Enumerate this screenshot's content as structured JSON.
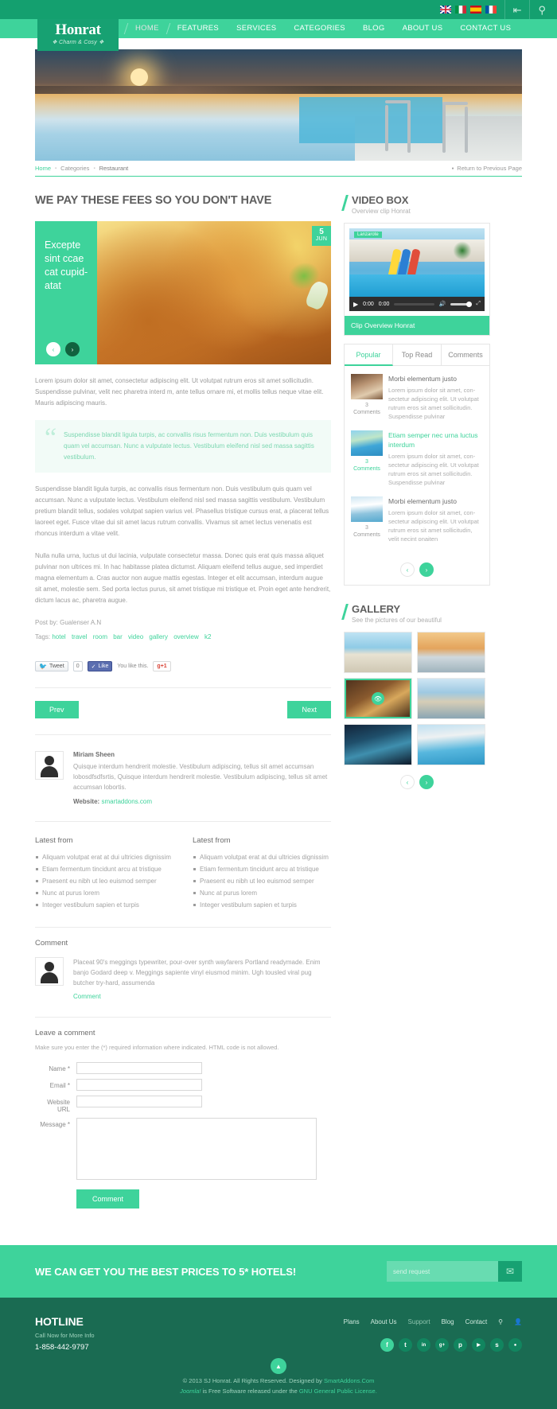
{
  "topbar": {
    "flags": [
      "uk-flag-icon",
      "italy-flag-icon",
      "spain-flag-icon",
      "france-flag-icon"
    ],
    "share_icon": "share-icon",
    "search_icon": "search-icon"
  },
  "logo": {
    "main": "Honrat",
    "sub": "Charm & Cosy"
  },
  "nav": [
    {
      "label": "HOME",
      "active": true
    },
    {
      "label": "FEATURES",
      "active": false
    },
    {
      "label": "SERVICES",
      "active": false
    },
    {
      "label": "CATEGORIES",
      "active": false
    },
    {
      "label": "BLOG",
      "active": false
    },
    {
      "label": "ABOUT US",
      "active": false
    },
    {
      "label": "CONTACT US",
      "active": false
    }
  ],
  "breadcrumb": {
    "home": "Home",
    "categories": "Categories",
    "current": "Restaurant",
    "return": "Return to Previous Page"
  },
  "article": {
    "title": "WE PAY THESE FEES SO YOU DON'T HAVE",
    "feature_caption": "Excepte sint ccae cat cupid-atat",
    "date_day": "5",
    "date_month": "JUN",
    "p1": "Lorem ipsum dolor sit amet, consectetur adipiscing elit. Ut volutpat rutrum eros sit amet sollicitudin. Suspendisse pulvinar, velit nec pharetra interd m, ante tellus ornare mi, et mollis tellus neque vitae elit. Mauris adipiscing mauris.",
    "quote": "Suspendisse blandit ligula turpis, ac convallis risus fermentum non. Duis vestibulum quis quam vel accumsan. Nunc a vulputate lectus. Vestibulum eleifend nisl sed massa sagittis vestibulum.",
    "p2": "Suspendisse blandit ligula turpis, ac convallis risus fermentum non. Duis vestibulum quis quam vel accumsan. Nunc a vulputate lectus. Vestibulum eleifend nisl sed massa sagittis vestibulum. Vestibulum pretium blandit tellus, sodales volutpat sapien varius vel. Phasellus tristique cursus erat, a placerat tellus laoreet eget. Fusce vitae dui sit amet lacus rutrum convallis. Vivamus sit amet lectus venenatis est rhoncus interdum a vitae velit.",
    "p3": "Nulla nulla urna, luctus ut dui lacinia, vulputate consectetur massa. Donec quis erat quis massa aliquet pulvinar non ultrices mi. In hac habitasse platea dictumst. Aliquam eleifend tellus augue, sed imperdiet magna elementum a. Cras auctor non augue mattis egestas. Integer et elit accumsan, interdum augue sit amet, molestie sem. Sed porta lectus purus, sit amet tristique mi tristique et. Proin eget ante hendrerit, dictum lacus ac, pharetra augue.",
    "post_by": "Post by: Gualenser A.N",
    "tags_label": "Tags:",
    "tags": [
      "hotel",
      "travel",
      "room",
      "bar",
      "video",
      "gallery",
      "overview",
      "k2"
    ]
  },
  "social": {
    "tweet_label": "Tweet",
    "tweet_count": "0",
    "like_label": "Like",
    "like_note": "You like this.",
    "gplus_label": "+1"
  },
  "pager": {
    "prev": "Prev",
    "next": "Next"
  },
  "author": {
    "name": "Miriam Sheen",
    "bio": "Quisque interdum hendrerit molestie. Vestibulum adipiscing, tellus sit amet accumsan lobosdfsdfsrtis, Quisque interdum hendrerit molestie. Vestibulum adipiscing, tellus sit amet accumsan lobortis.",
    "website_label": "Website:",
    "website": "smartaddons.com"
  },
  "latest_left": {
    "title": "Latest from",
    "items": [
      "Aliquam volutpat erat at dui ultricies dignissim",
      "Etiam fermentum tincidunt arcu at tristique",
      "Praesent eu nibh ut leo euismod semper",
      "Nunc at purus lorem",
      "Integer vestibulum sapien et turpis"
    ]
  },
  "latest_right": {
    "title": "Latest from",
    "items": [
      "Aliquam volutpat erat at dui ultricies dignissim",
      "Etiam fermentum tincidunt arcu at tristique",
      "Praesent eu nibh ut leo euismod semper",
      "Nunc at purus lorem",
      "Integer vestibulum sapien et turpis"
    ]
  },
  "comments": {
    "heading": "Comment",
    "body": "Placeat 90's meggings typewriter, pour-over synth wayfarers Portland readymade. Enim banjo Godard deep v. Meggings sapiente vinyl eiusmod minim. Ugh tousled viral pug butcher try-hard, assumenda",
    "reply": "Comment"
  },
  "form": {
    "heading": "Leave a comment",
    "note": "Make sure you enter the (*) required information where indicated. HTML code is not allowed.",
    "name_label": "Name *",
    "email_label": "Email *",
    "url_label": "Website URL",
    "message_label": "Message *",
    "name_value": "",
    "email_value": "",
    "url_value": "",
    "message_value": "",
    "submit": "Comment"
  },
  "video_box": {
    "title": "VIDEO BOX",
    "subtitle": "Overview clip Honrat",
    "badge": "Lanzarote",
    "current_time": "0:00",
    "total_time": "0:00",
    "caption": "Clip Overview Honrat",
    "play_icon": "play-icon",
    "volume_icon": "volume-icon",
    "fullscreen_icon": "fullscreen-icon"
  },
  "tabs": [
    {
      "label": "Popular",
      "active": true
    },
    {
      "label": "Top Read",
      "active": false
    },
    {
      "label": "Comments",
      "active": false
    }
  ],
  "posts": [
    {
      "title": "Morbi elementum justo",
      "highlight": false,
      "count": "3",
      "count_label": "Comments",
      "excerpt": "Lorem ipsum dolor sit amet, con-sectetur adipiscing elit. Ut volutpat rutrum eros sit amet sollicitudin. Suspendisse pulvinar",
      "thumb": "hotel-room-thumb"
    },
    {
      "title": "Etiam semper nec urna luctus interdum",
      "highlight": true,
      "count": "3",
      "count_label": "Comments",
      "excerpt": "Lorem ipsum dolor sit amet, con-sectetur adipiscing elit. Ut volutpat rutrum eros sit amet sollicitudin. Suspendisse pulvinar",
      "thumb": "pool-thumb"
    },
    {
      "title": "Morbi elementum justo",
      "highlight": false,
      "count": "3",
      "count_label": "Comments",
      "excerpt": "Lorem ipsum dolor sit amet, con-sectetur adipiscing elit. Ut volutpat rutrum eros sit amet sollicitudin, velit necint onaiten",
      "thumb": "beach-thumb"
    }
  ],
  "gallery": {
    "title": "GALLERY",
    "subtitle": "See the pictures of our beautiful",
    "items": [
      "balcony-sea-view",
      "terrace-sunset",
      "hotel-suite-interior",
      "bridge-river",
      "night-resort-pool",
      "resort-pool-day"
    ]
  },
  "cta": {
    "text": "WE CAN GET YOU THE BEST PRICES TO 5* HOTELS!",
    "placeholder": "send request",
    "value": "",
    "button_icon": "envelope-icon"
  },
  "footer": {
    "hotline_title": "HOTLINE",
    "hotline_sub": "Call Now for More Info",
    "hotline_number": "1-858-442-9797",
    "links": [
      {
        "label": "Plans",
        "muted": false
      },
      {
        "label": "About Us",
        "muted": false
      },
      {
        "label": "Support",
        "muted": true
      },
      {
        "label": "Blog",
        "muted": false
      },
      {
        "label": "Contact",
        "muted": false
      }
    ],
    "search_icon": "search-icon",
    "user_icon": "user-icon",
    "socials": [
      {
        "name": "facebook-icon",
        "glyph": "f",
        "color": "#3ed39b"
      },
      {
        "name": "twitter-icon",
        "glyph": "t",
        "color": "#11855f"
      },
      {
        "name": "linkedin-icon",
        "glyph": "in",
        "color": "#11855f"
      },
      {
        "name": "googleplus-icon",
        "glyph": "g+",
        "color": "#11855f"
      },
      {
        "name": "pinterest-icon",
        "glyph": "p",
        "color": "#11855f"
      },
      {
        "name": "youtube-icon",
        "glyph": "▶",
        "color": "#11855f"
      },
      {
        "name": "skype-icon",
        "glyph": "s",
        "color": "#11855f"
      },
      {
        "name": "rss-icon",
        "glyph": "●",
        "color": "#11855f"
      }
    ],
    "to_top_icon": "chevron-up-icon",
    "copyright_1_pre": "© 2013 SJ Honrat. All Rights Reserved. Designed by ",
    "copyright_1_link": "SmartAddons.Com",
    "copyright_2_a": "Joomla!",
    "copyright_2_b": " is Free Software released under the ",
    "copyright_2_link": "GNU General Public License."
  },
  "colors": {
    "accent": "#3ed39b",
    "dark": "#17a172",
    "footer": "#1a6b52"
  }
}
